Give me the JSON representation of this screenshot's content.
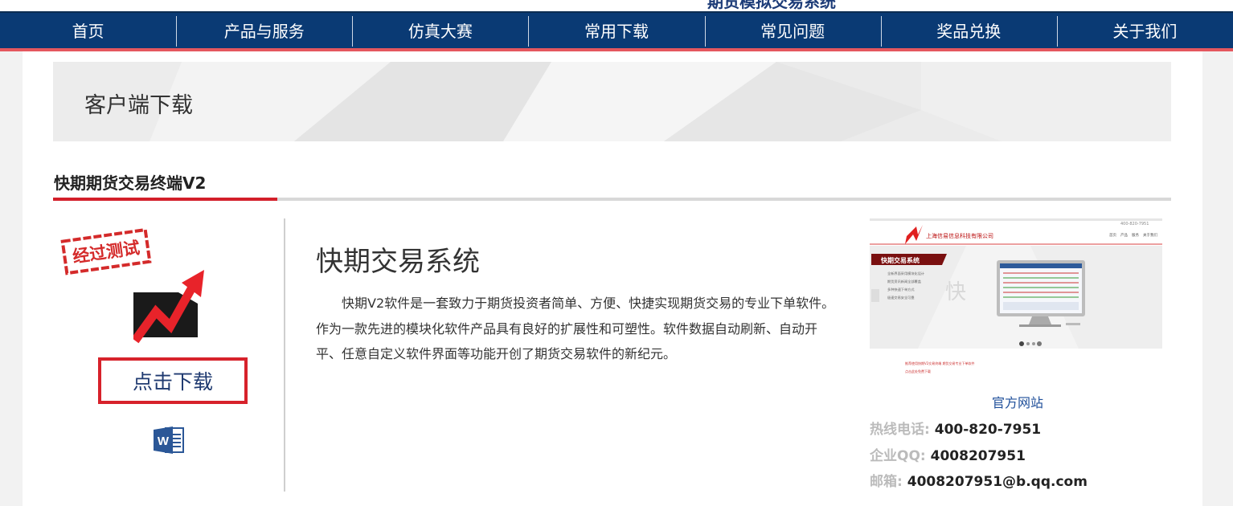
{
  "header": {
    "site_title_clipped": "期货模拟交易系统"
  },
  "nav": {
    "items": [
      {
        "label": "首页"
      },
      {
        "label": "产品与服务"
      },
      {
        "label": "仿真大赛"
      },
      {
        "label": "常用下载"
      },
      {
        "label": "常见问题"
      },
      {
        "label": "奖品兑换"
      },
      {
        "label": "关于我们"
      }
    ]
  },
  "banner": {
    "title": "客户端下载"
  },
  "product": {
    "title": "快期期货交易终端V2",
    "stamp_text": "经过测试",
    "download_label": "点击下载",
    "system_title": "快期交易系统",
    "description": "快期V2软件是一套致力于期货投资者简单、方便、快捷实现期货交易的专业下单软件。作为一款先进的模块化软件产品具有良好的扩展性和可塑性。软件数据自动刷新、自动开平、任意自定义软件界面等功能开创了期货交易软件的新纪元。"
  },
  "preview": {
    "company": "上海信易信息科技有限公司",
    "hotline_small": "400-820-7951",
    "menu": [
      "首页",
      "产品",
      "服务",
      "关于我们"
    ],
    "panel_title": "快期交易系统",
    "bullets": [
      "全新界面采用模块化设计",
      "期货资讯新闻全部覆盖",
      "多种快速下单方式",
      "极速交易安全可靠"
    ],
    "watermark": "快",
    "footer1": "推荐使用快期V2交易终端 期货交易专业下单软件",
    "footer2": "点击此处免费下载"
  },
  "sidebar": {
    "site_link": "官方网站",
    "hotline_label": "热线电话:",
    "hotline_value": "400-820-7951",
    "qq_label": "企业QQ:",
    "qq_value": "4008207951",
    "email_label": "邮箱:",
    "email_value": "4008207951@b.qq.com"
  },
  "colors": {
    "nav_bg": "#0a3a74",
    "accent_red": "#d31f2a",
    "nav_underline": "#e5575e",
    "link_blue": "#1f4f9a"
  }
}
